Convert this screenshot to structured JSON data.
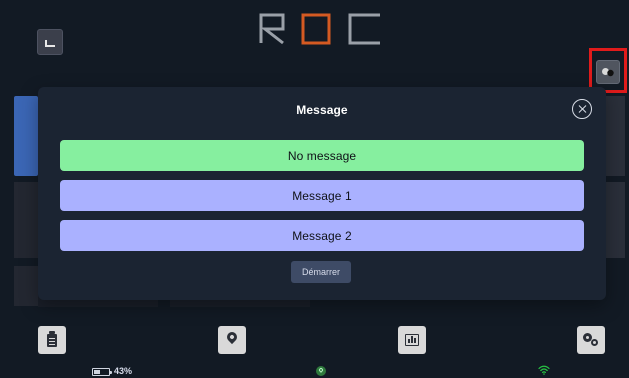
{
  "logo": {
    "text": "ROC",
    "colors": {
      "R": "#9aa0a8",
      "O": "#d45a22",
      "C": "#9aa0a8"
    }
  },
  "modal": {
    "title": "Message",
    "options": [
      {
        "label": "No message",
        "color": "#86ef9f",
        "state": "selected"
      },
      {
        "label": "Message 1",
        "color": "#aab1ff",
        "state": "default"
      },
      {
        "label": "Message 2",
        "color": "#aab1ff",
        "state": "default"
      }
    ],
    "primary_action_label": "Démarrer"
  },
  "status": {
    "battery_percent": 43,
    "battery_text": "43%"
  },
  "icons": {
    "top_left": "corner-icon",
    "top_right": "toggle-icon",
    "close": "close-icon",
    "bottom": [
      "clipboard-icon",
      "location-icon",
      "chart-icon",
      "settings-icon"
    ],
    "wifi": "wifi-icon"
  },
  "colors": {
    "background": "#121a24",
    "modal_background": "#1b2432",
    "highlight_red": "#e01b1b",
    "button_green": "#86ef9f",
    "button_purple": "#aab1ff",
    "start_button_bg": "#3e4b66"
  }
}
